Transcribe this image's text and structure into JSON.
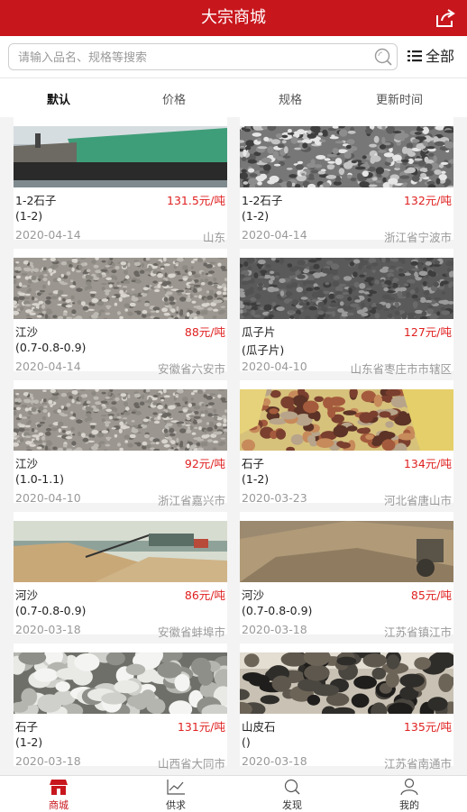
{
  "header": {
    "title": "大宗商城",
    "share_icon": "share-icon"
  },
  "search": {
    "placeholder": "请输入品名、规格等搜索",
    "value": "",
    "search_icon": "search-icon",
    "all_label": "全部"
  },
  "sort_tabs": [
    {
      "label": "默认",
      "active": true
    },
    {
      "label": "价格",
      "active": false
    },
    {
      "label": "规格",
      "active": false
    },
    {
      "label": "更新时间",
      "active": false
    }
  ],
  "products": [
    {
      "name": "1-2石子",
      "spec": "(1-2)",
      "price": "131.5元/吨",
      "date": "2020-04-14",
      "location": "山东",
      "image": "barge"
    },
    {
      "name": "1-2石子",
      "spec": "(1-2)",
      "price": "132元/吨",
      "date": "2020-04-14",
      "location": "浙江省宁波市",
      "image": "gravel-coarse"
    },
    {
      "name": "江沙",
      "spec": "(0.7-0.8-0.9)",
      "price": "88元/吨",
      "date": "2020-04-14",
      "location": "安徽省六安市",
      "image": "gravel-fine"
    },
    {
      "name": "瓜子片",
      "spec": "(瓜子片)",
      "price": "127元/吨",
      "date": "2020-04-10",
      "location": "山东省枣庄市市辖区",
      "image": "gravel-dark"
    },
    {
      "name": "江沙",
      "spec": "(1.0-1.1)",
      "price": "92元/吨",
      "date": "2020-04-10",
      "location": "浙江省嘉兴市",
      "image": "gravel-fine"
    },
    {
      "name": "石子",
      "spec": "(1-2)",
      "price": "134元/吨",
      "date": "2020-03-23",
      "location": "河北省唐山市",
      "image": "stones-bag"
    },
    {
      "name": "河沙",
      "spec": "(0.7-0.8-0.9)",
      "price": "86元/吨",
      "date": "2020-03-18",
      "location": "安徽省蚌埠市",
      "image": "sand-conveyor"
    },
    {
      "name": "河沙",
      "spec": "(0.7-0.8-0.9)",
      "price": "85元/吨",
      "date": "2020-03-18",
      "location": "江苏省镇江市",
      "image": "sand-pile"
    },
    {
      "name": "石子",
      "spec": "(1-2)",
      "price": "131元/吨",
      "date": "2020-03-18",
      "location": "山西省大同市",
      "image": "white-rocks"
    },
    {
      "name": "山皮石",
      "spec": "()",
      "price": "135元/吨",
      "date": "2020-03-18",
      "location": "江苏省南通市",
      "image": "dark-rocks"
    }
  ],
  "bottom_nav": [
    {
      "label": "商城",
      "icon": "shop-icon",
      "active": true
    },
    {
      "label": "供求",
      "icon": "trend-icon",
      "active": false
    },
    {
      "label": "发现",
      "icon": "discover-icon",
      "active": false
    },
    {
      "label": "我的",
      "icon": "user-icon",
      "active": false
    }
  ],
  "colors": {
    "brand": "#c8161d",
    "price": "#e02020",
    "muted": "#999999"
  }
}
